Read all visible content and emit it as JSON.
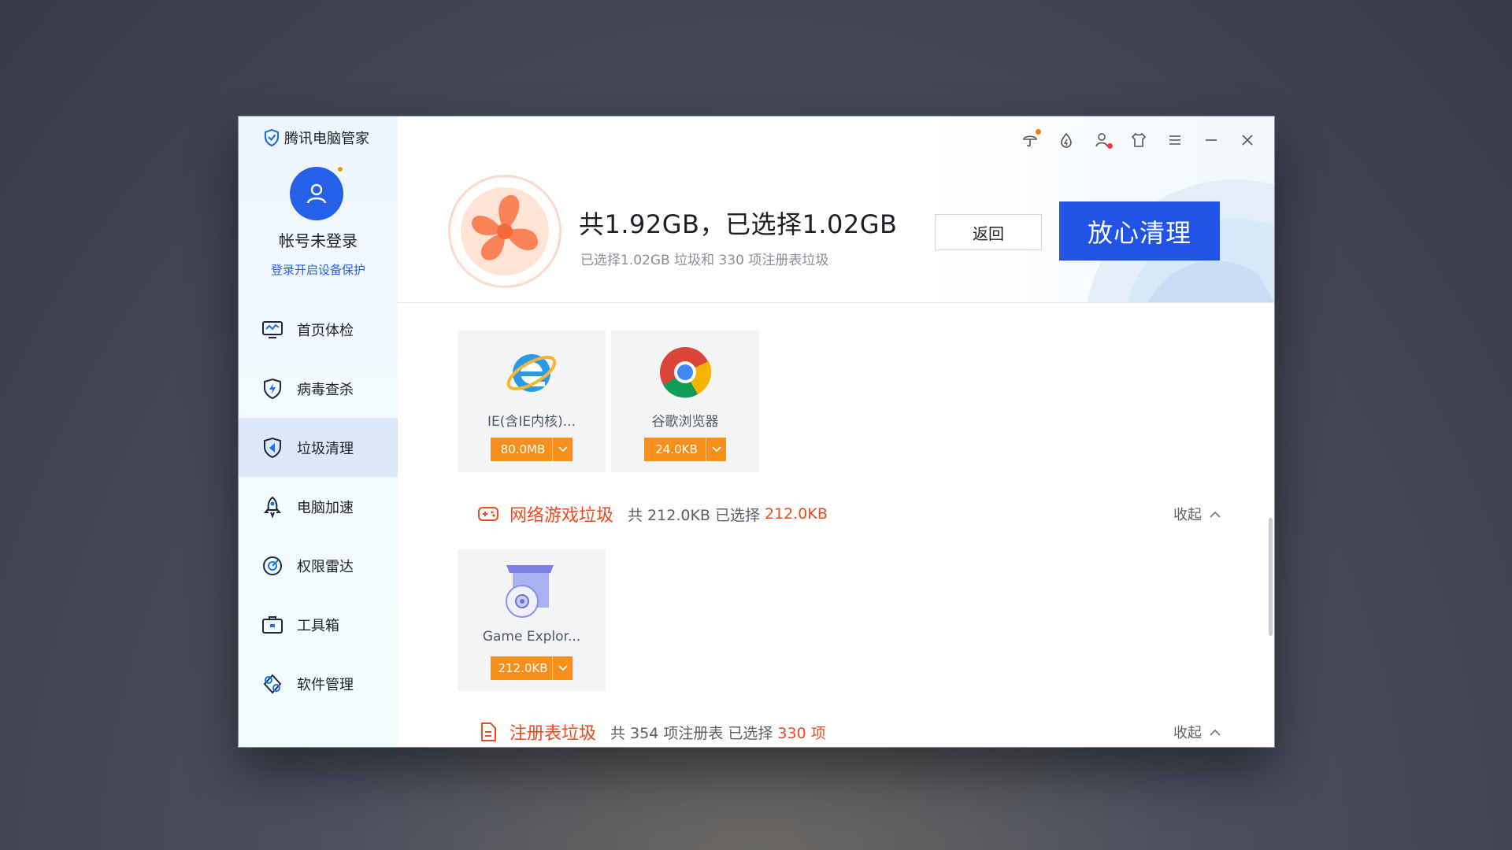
{
  "brand": {
    "name": "腾讯电脑管家"
  },
  "account": {
    "name": "帐号未登录",
    "login_link": "登录开启设备保护"
  },
  "nav": {
    "items": [
      {
        "label": "首页体检",
        "icon": "monitor-icon",
        "active": false
      },
      {
        "label": "病毒查杀",
        "icon": "shield-bolt-icon",
        "active": false
      },
      {
        "label": "垃圾清理",
        "icon": "clean-icon",
        "active": true
      },
      {
        "label": "电脑加速",
        "icon": "rocket-icon",
        "active": false
      },
      {
        "label": "权限雷达",
        "icon": "radar-icon",
        "active": false
      },
      {
        "label": "工具箱",
        "icon": "toolbox-icon",
        "active": false
      },
      {
        "label": "软件管理",
        "icon": "software-icon",
        "active": false
      }
    ]
  },
  "summary": {
    "title": "共1.92GB，已选择1.02GB",
    "subtitle": "已选择1.02GB 垃圾和 330 项注册表垃圾",
    "back_label": "返回",
    "clean_label": "放心清理"
  },
  "browser_cards": [
    {
      "name": "IE(含IE内核)...",
      "size": "80.0MB"
    },
    {
      "name": "谷歌浏览器",
      "size": "24.0KB"
    }
  ],
  "game_section": {
    "title": "网络游戏垃圾",
    "info": "共 212.0KB 已选择",
    "selected": "212.0KB",
    "collapse_label": "收起"
  },
  "game_cards": [
    {
      "name": "Game Explor...",
      "size": "212.0KB"
    }
  ],
  "registry_section": {
    "title": "注册表垃圾",
    "info": "共 354 项注册表 已选择",
    "selected": "330 项",
    "collapse_label": "收起"
  },
  "colors": {
    "accent": "#2154e6",
    "orange": "#f5901c",
    "warning_red": "#ef4a1e"
  }
}
